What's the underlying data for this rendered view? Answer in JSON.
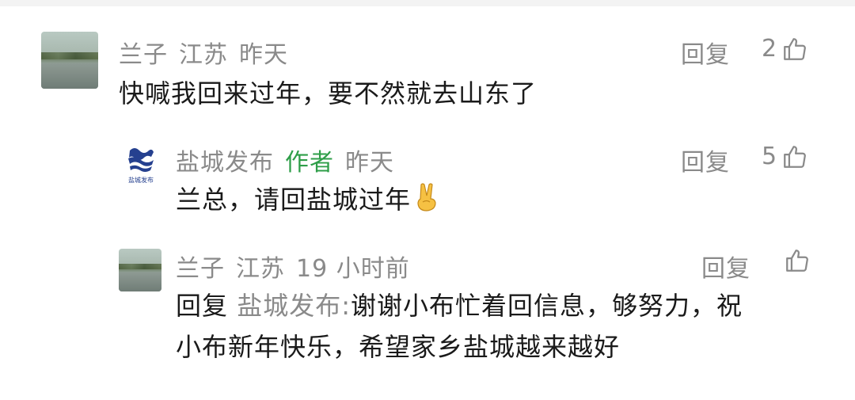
{
  "comments": [
    {
      "author": "兰子",
      "location": "江苏",
      "time": "昨天",
      "reply_label": "回复",
      "likes": "2",
      "text": "快喊我回来过年，要不然就去山东了",
      "avatar": "lake-photo-avatar"
    },
    {
      "author": "盐城发布",
      "author_tag": "作者",
      "time": "昨天",
      "reply_label": "回复",
      "likes": "5",
      "text": "兰总，请回盐城过年",
      "emoji": "victory-hand-emoji",
      "avatar": "yancheng-logo-avatar",
      "logo_text": "盐城发布"
    },
    {
      "author": "兰子",
      "location": "江苏",
      "time": "19 小时前",
      "reply_label": "回复",
      "likes": "",
      "reply_prefix": "回复",
      "reply_target": "盐城发布:",
      "text_line1": "谢谢小布忙着回信息，够努力，祝",
      "text_line2": "小布新年快乐，希望家乡盐城越来越好",
      "avatar": "lake-photo-avatar"
    }
  ],
  "colors": {
    "meta_gray": "#8a8a8a",
    "author_green": "#2e9e48",
    "text": "#1a1a1a"
  }
}
